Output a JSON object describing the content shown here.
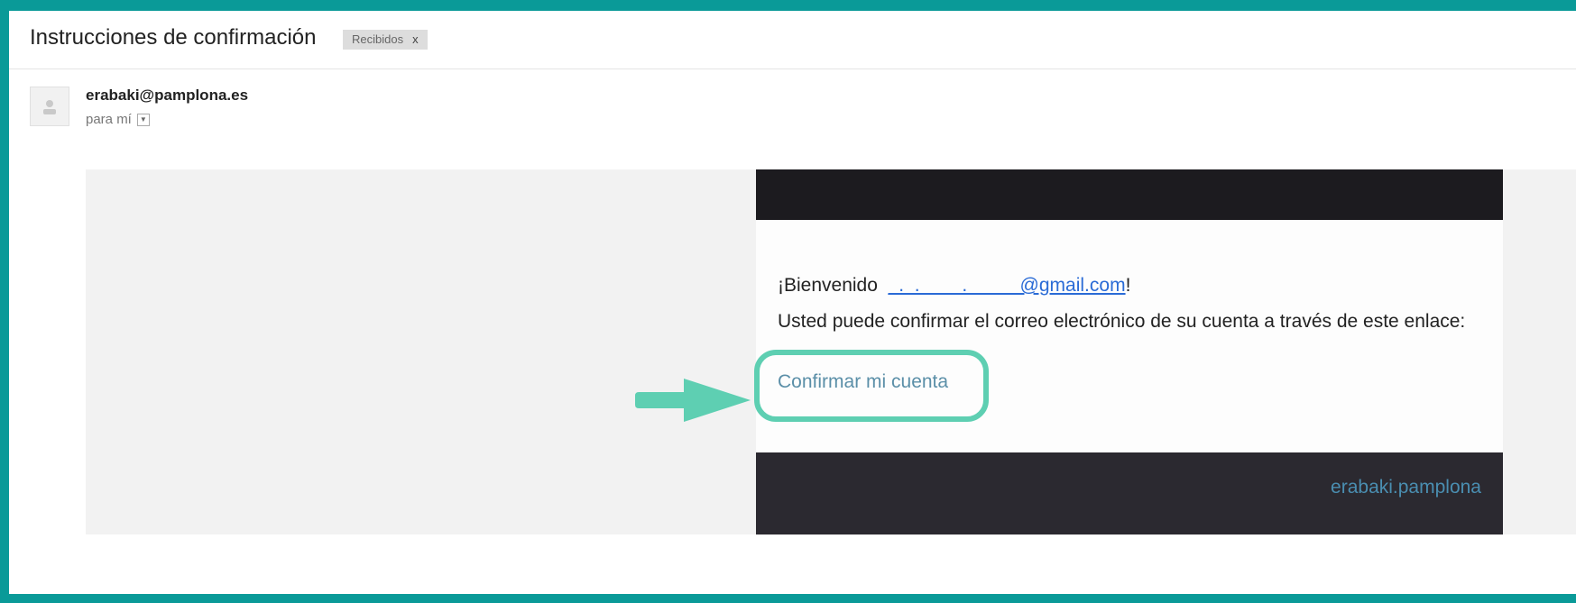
{
  "subject": {
    "title": "Instrucciones de confirmación",
    "label": "Recibidos",
    "label_remove": "x"
  },
  "header": {
    "sender": "erabaki@pamplona.es",
    "recipient": "para mí"
  },
  "email": {
    "greeting_prefix": "¡Bienvenido",
    "email_address": "_._.____._____@gmail.com",
    "greeting_suffix": "!",
    "instruction": "Usted puede confirmar el correo electrónico de su cuenta a través de este enlace:",
    "confirm_link": "Confirmar mi cuenta",
    "footer_link": "erabaki.pamplona"
  },
  "colors": {
    "frame": "#0a9a98",
    "highlight": "#5ecfb2",
    "link": "#5b8fa8"
  }
}
